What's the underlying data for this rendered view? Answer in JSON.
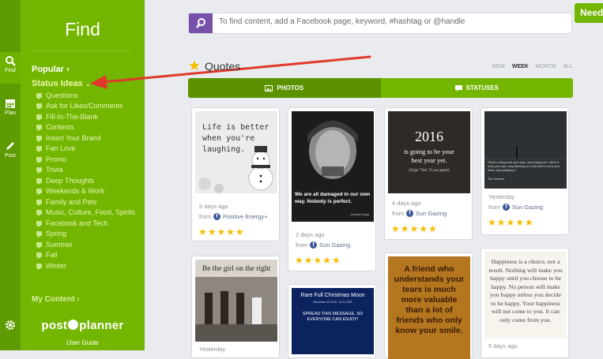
{
  "rail": {
    "items": [
      {
        "label": "Find",
        "icon": "search-icon"
      },
      {
        "label": "Plan",
        "icon": "calendar-icon"
      },
      {
        "label": "Post",
        "icon": "pencil-icon"
      },
      {
        "label": "",
        "icon": "gear-icon"
      }
    ]
  },
  "sidebar": {
    "title": "Find",
    "popular": "Popular",
    "status_ideas": "Status Ideas",
    "sub_items": [
      "Questions",
      "Ask for Likes/Comments",
      "Fill-In-The-Blank",
      "Contests",
      "Insert Your Brand",
      "Fan Love",
      "Promo",
      "Trivia",
      "Deep Thoughts",
      "Weekends & Work",
      "Family and Pets",
      "Music, Culture, Food, Spirits",
      "Facebook and Tech",
      "Spring",
      "Summer",
      "Fall",
      "Winter"
    ],
    "my_content": "My Content",
    "logo_left": "post",
    "logo_right": "planner",
    "guide": "User Guide"
  },
  "search": {
    "placeholder": "To find content, add a Facebook page, keyword, #hashtag or @handle"
  },
  "need_button": "Need",
  "section": {
    "title": "Quotes",
    "filters": [
      "NEW",
      "WEEK",
      "MONTH",
      "ALL"
    ],
    "active_filter": "WEEK"
  },
  "tabs": {
    "photos": "PHOTOS",
    "statuses": "STATUSES"
  },
  "cards": [
    {
      "image_text": "Life is better when you're laughing.",
      "date": "5 days ago",
      "from": "from",
      "source": "Positive Energy+",
      "rating": "★★★★★"
    },
    {
      "image_text": "We are all damaged in our own way. Nobody is perfect.",
      "image_credit": "Johnny Depp",
      "date": "2 days ago",
      "from": "from",
      "source": "Sun Gazing",
      "rating": "★★★★★"
    },
    {
      "image_text": "2016",
      "image_text_2": "is going to be your best year yet.",
      "image_text_3": "(Type \"Yes\" if you agree)",
      "date": "4 days ago",
      "from": "from",
      "source": "Sun Gazing",
      "rating": "★★★★★"
    },
    {
      "image_text": "\"When a thing hurts your eyes, stop looking at it. When it hurts your ears, stop listening to it. And when it hurts your heart, stop justifying it.\"",
      "image_credit": "The Universe",
      "date": "Yesterday",
      "from": "from",
      "source": "Sun Gazing",
      "rating": "★★★★★"
    },
    {
      "image_text": "Be the girl on the right",
      "date": "Yesterday"
    },
    {
      "image_text": "Rare Full Christmas Moon",
      "image_text_2": "December 25 2015 - 11:11 GMT",
      "image_text_3": "SPREAD THIS MESSAGE, SO EVERYONE CAN ENJOY!"
    },
    {
      "image_text": "A friend who understands your tears is much more valuable than a lot of friends who only know your smile."
    },
    {
      "image_text": "Happiness is a choice, not a result. Nothing will make you happy until you choose to be happy. No person will make you happy unless you decide to be happy. Your happiness will not come to you. It can only come from you.",
      "date": "5 days ago"
    }
  ]
}
